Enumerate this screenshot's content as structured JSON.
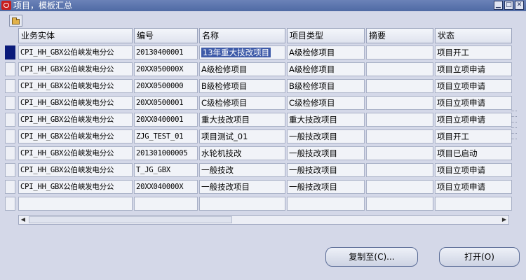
{
  "window": {
    "title": "项目，模板汇总"
  },
  "window_buttons": {
    "minimize": "▁",
    "maximize": "□",
    "close": "✕"
  },
  "table": {
    "columns": [
      "业务实体",
      "编号",
      "名称",
      "项目类型",
      "摘要",
      "状态"
    ],
    "rows": [
      [
        "CPI_HH_GBX公伯峡发电分公",
        "20130400001",
        "13年重大技改项目",
        "A级检修项目",
        "",
        "项目开工"
      ],
      [
        "CPI_HH_GBX公伯峡发电分公",
        "20XX050000X",
        "A级检修项目",
        "A级检修项目",
        "",
        "项目立项申请"
      ],
      [
        "CPI_HH_GBX公伯峡发电分公",
        "20XX0500000",
        "B级检修项目",
        "B级检修项目",
        "",
        "项目立项申请"
      ],
      [
        "CPI_HH_GBX公伯峡发电分公",
        "20XX0500001",
        "C级检修项目",
        "C级检修项目",
        "",
        "项目立项申请"
      ],
      [
        "CPI_HH_GBX公伯峡发电分公",
        "20XX0400001",
        "重大技改项目",
        "重大技改项目",
        "",
        "项目立项申请"
      ],
      [
        "CPI_HH_GBX公伯峡发电分公",
        "ZJG_TEST_01",
        "项目测试_01",
        "一般技改项目",
        "",
        "项目开工"
      ],
      [
        "CPI_HH_GBX公伯峡发电分公",
        "201301000005",
        "水轮机技改",
        "一般技改项目",
        "",
        "项目已启动"
      ],
      [
        "CPI_HH_GBX公伯峡发电分公",
        "T_JG_GBX",
        "一般技改",
        "一般技改项目",
        "",
        "项目立项申请"
      ],
      [
        "CPI_HH_GBX公伯峡发电分公",
        "20XX040000X",
        "一般技改项目",
        "一般技改项目",
        "",
        "项目立项申请"
      ],
      [
        "",
        "",
        "",
        "",
        "",
        ""
      ]
    ]
  },
  "buttons": {
    "copy_to": "复制至(C)...",
    "open": "打开(O)"
  }
}
